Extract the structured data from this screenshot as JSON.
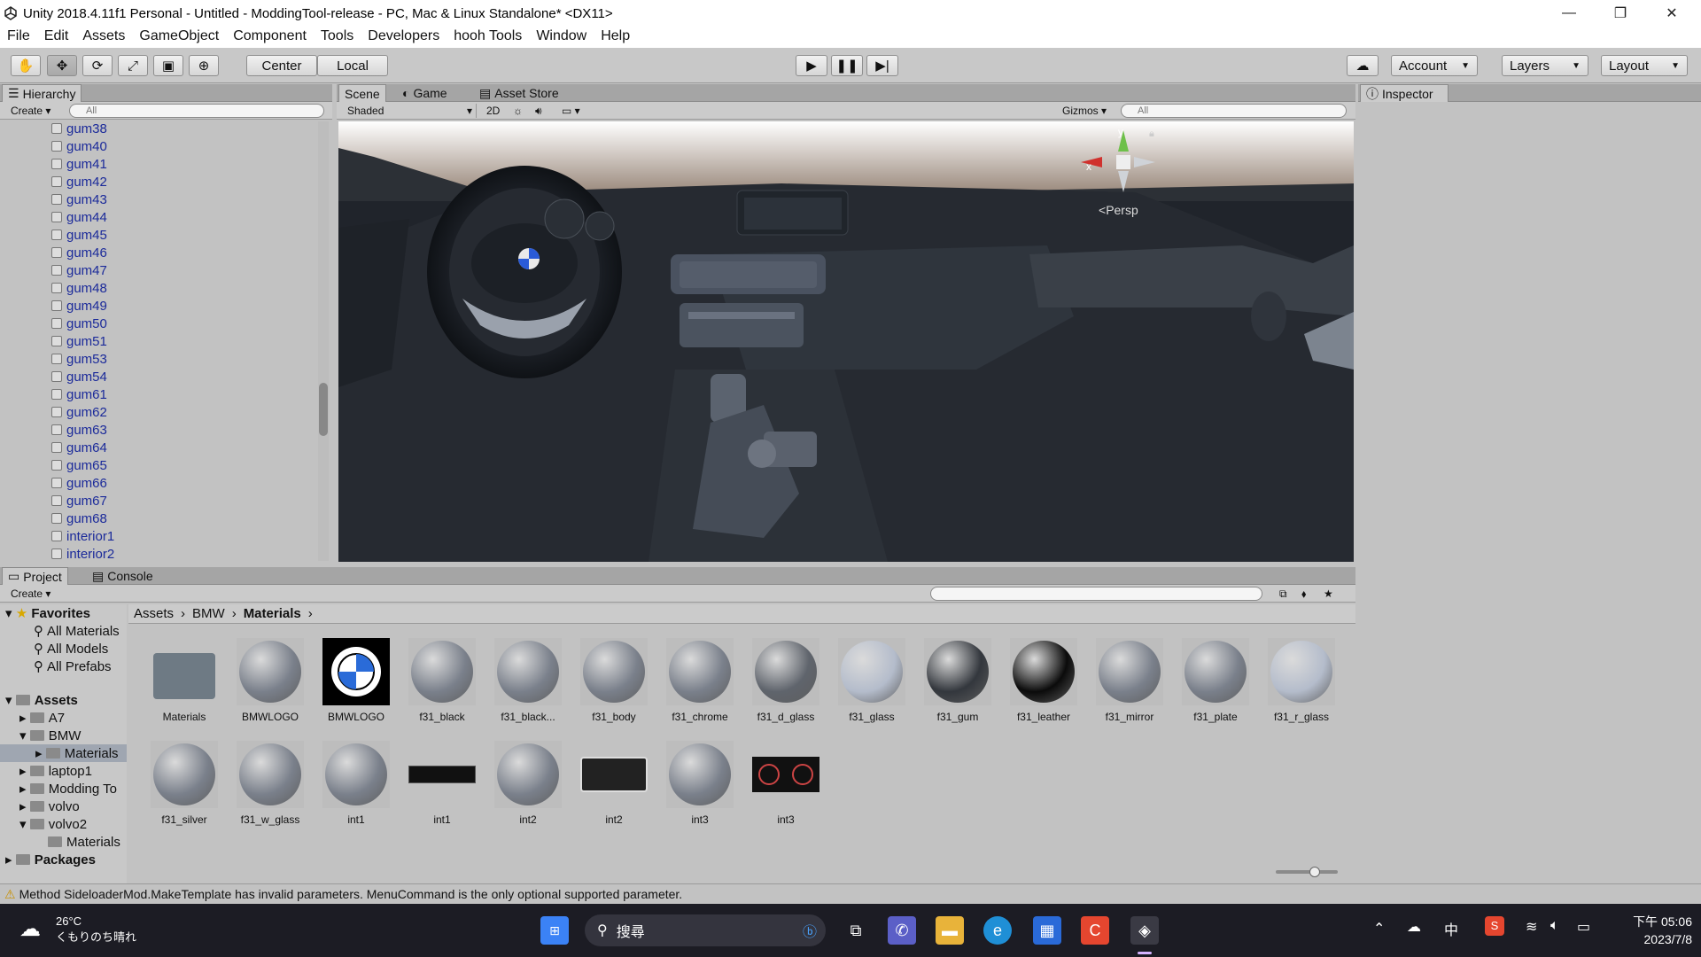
{
  "window": {
    "title": "Unity 2018.4.11f1 Personal - Untitled - ModdingTool-release - PC, Mac & Linux Standalone* <DX11>",
    "minimize": "—",
    "maximize": "❐",
    "close": "✕"
  },
  "menu": [
    "File",
    "Edit",
    "Assets",
    "GameObject",
    "Component",
    "Tools",
    "Developers",
    "hooh Tools",
    "Window",
    "Help"
  ],
  "toolbar": {
    "pivot_center": "Center",
    "pivot_local": "Local",
    "account": "Account",
    "layers": "Layers",
    "layout": "Layout"
  },
  "hierarchy": {
    "tab": "Hierarchy",
    "create": "Create",
    "search_placeholder": "All",
    "items": [
      "gum38",
      "gum40",
      "gum41",
      "gum42",
      "gum43",
      "gum44",
      "gum45",
      "gum46",
      "gum47",
      "gum48",
      "gum49",
      "gum50",
      "gum51",
      "gum53",
      "gum54",
      "gum61",
      "gum62",
      "gum63",
      "gum64",
      "gum65",
      "gum66",
      "gum67",
      "gum68",
      "interior1",
      "interior2"
    ]
  },
  "scene": {
    "tabs": [
      "Scene",
      "Game",
      "Asset Store"
    ],
    "shading": "Shaded",
    "mode_2d": "2D",
    "gizmos": "Gizmos",
    "search_placeholder": "All",
    "axis_y": "y",
    "axis_x": "x",
    "persp": "Persp"
  },
  "inspector": {
    "tab": "Inspector"
  },
  "project": {
    "tabs": [
      "Project",
      "Console"
    ],
    "create": "Create",
    "breadcrumb": [
      "Assets",
      "BMW",
      "Materials"
    ],
    "favorites": {
      "label": "Favorites",
      "items": [
        "All Materials",
        "All Models",
        "All Prefabs"
      ]
    },
    "tree": {
      "assets": "Assets",
      "a7": "A7",
      "bmw": "BMW",
      "materials": "Materials",
      "laptop1": "laptop1",
      "modding": "Modding To",
      "volvo": "volvo",
      "volvo2": "volvo2",
      "volvo2_materials": "Materials",
      "packages": "Packages"
    },
    "assets_row1": [
      "Materials",
      "BMWLOGO",
      "BMWLOGO",
      "f31_black",
      "f31_black...",
      "f31_body",
      "f31_chrome",
      "f31_d_glass",
      "f31_glass",
      "f31_gum",
      "f31_leather",
      "f31_mirror",
      "f31_plate",
      "f31_r_glass"
    ],
    "assets_row2": [
      "f31_silver",
      "f31_w_glass",
      "int1",
      "int1",
      "int2",
      "int2",
      "int3",
      "int3"
    ]
  },
  "status": {
    "message": "Method SideloaderMod.MakeTemplate has invalid parameters. MenuCommand is the only optional supported parameter."
  },
  "taskbar": {
    "temperature": "26°C",
    "weather": "くもりのち晴れ",
    "search": "搜尋",
    "ime": "中",
    "time": "下午 05:06",
    "date": "2023/7/8"
  },
  "colors": {
    "accent": "#1b2a9a",
    "panel": "#c2c2c2",
    "taskbar": "#1c1c24"
  }
}
